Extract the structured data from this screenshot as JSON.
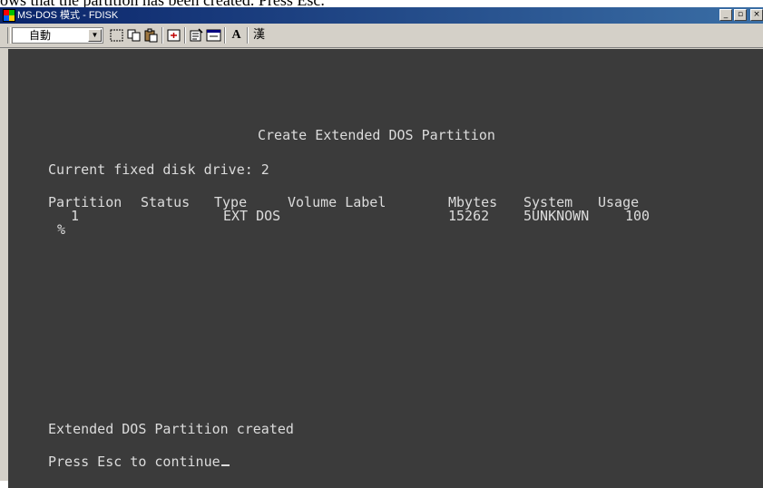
{
  "caption_text": "ows that the partition has been created. Press Esc.",
  "window": {
    "title": "MS-DOS 模式 - FDISK",
    "controls": {
      "minimize": "_",
      "restore": "▫",
      "close": "×"
    }
  },
  "toolbar": {
    "font_size_value": "自動",
    "tools": [
      "mark-icon",
      "copy-icon",
      "paste-icon",
      "fullscreen-icon",
      "properties-icon",
      "background-icon",
      "font-icon",
      "kanji-icon"
    ],
    "font_label": "A",
    "kanji_label": "漢"
  },
  "screen": {
    "heading": "Create Extended DOS Partition",
    "drive_line": "Current fixed disk drive: 2",
    "columns": [
      "Partition",
      "Status",
      "Type",
      "Volume Label",
      "Mbytes",
      "System",
      "Usage"
    ],
    "row": {
      "partition": "1",
      "status": "",
      "type": "EXT DOS",
      "volume_label": "",
      "mbytes": "15262",
      "system": "5UNKNOWN",
      "usage": "100",
      "usage_unit": "%"
    },
    "message": "Extended DOS Partition created",
    "prompt": "Press Esc to continue"
  },
  "colors": {
    "terminal_bg": "#3b3b3b",
    "terminal_fg": "#dcdcdc",
    "titlebar": "#0a246a"
  }
}
